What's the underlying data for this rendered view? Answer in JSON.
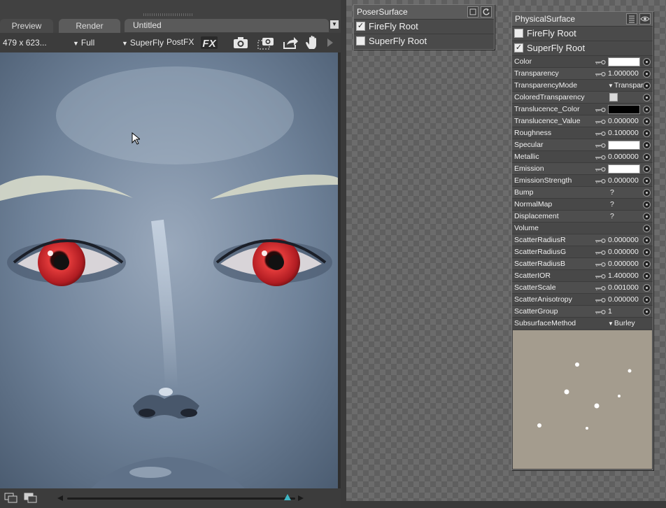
{
  "render_panel": {
    "tabs": [
      {
        "label": "Preview"
      },
      {
        "label": "Render"
      }
    ],
    "document_title": "Untitled",
    "toolbar": {
      "resolution": "479 x 623...",
      "quality": "Full",
      "engine": "SuperFly",
      "postfx": "PostFX",
      "icons": [
        "fx-icon",
        "camera-icon",
        "area-render-icon",
        "export-icon",
        "hand-icon",
        "play-arrow-icon"
      ]
    }
  },
  "poser_surface": {
    "title": "PoserSurface",
    "roots": [
      {
        "label": "FireFly Root",
        "checked": true
      },
      {
        "label": "SuperFly Root",
        "checked": false
      }
    ]
  },
  "physical_surface": {
    "title": "PhysicalSurface",
    "roots": [
      {
        "label": "FireFly Root",
        "checked": false
      },
      {
        "label": "SuperFly Root",
        "checked": true
      }
    ],
    "params": [
      {
        "name": "Color",
        "kind": "color",
        "color": "#ffffff"
      },
      {
        "name": "Transparency",
        "kind": "value",
        "value": "1.000000"
      },
      {
        "name": "TransparencyMode",
        "kind": "dropdown",
        "value": "Transpare"
      },
      {
        "name": "ColoredTransparency",
        "kind": "check",
        "checked": false
      },
      {
        "name": "Translucence_Color",
        "kind": "color",
        "color": "#000000"
      },
      {
        "name": "Translucence_Value",
        "kind": "value",
        "value": "0.000000"
      },
      {
        "name": "Roughness",
        "kind": "value",
        "value": "0.100000"
      },
      {
        "name": "Specular",
        "kind": "color",
        "color": "#ffffff"
      },
      {
        "name": "Metallic",
        "kind": "value",
        "value": "0.000000"
      },
      {
        "name": "Emission",
        "kind": "color",
        "color": "#ffffff"
      },
      {
        "name": "EmissionStrength",
        "kind": "value",
        "value": "0.000000"
      },
      {
        "name": "Bump",
        "kind": "unknown",
        "value": "?"
      },
      {
        "name": "NormalMap",
        "kind": "unknown",
        "value": "?"
      },
      {
        "name": "Displacement",
        "kind": "unknown",
        "value": "?"
      },
      {
        "name": "Volume",
        "kind": "empty"
      },
      {
        "name": "ScatterRadiusR",
        "kind": "value",
        "value": "0.000000"
      },
      {
        "name": "ScatterRadiusG",
        "kind": "value",
        "value": "0.000000"
      },
      {
        "name": "ScatterRadiusB",
        "kind": "value",
        "value": "0.000000"
      },
      {
        "name": "ScatterIOR",
        "kind": "value",
        "value": "1.400000"
      },
      {
        "name": "ScatterScale",
        "kind": "value",
        "value": "0.001000"
      },
      {
        "name": "ScatterAnisotropy",
        "kind": "value",
        "value": "0.000000"
      },
      {
        "name": "ScatterGroup",
        "kind": "value",
        "value": "1"
      },
      {
        "name": "SubsurfaceMethod",
        "kind": "dropdown-noport",
        "value": "Burley"
      }
    ]
  },
  "colors": {
    "panel_bg": "#414141",
    "node_bg": "#444444",
    "skin_blue": "#6e8197",
    "eye_red": "#c0242a",
    "preview_bg": "#a49c8e",
    "accent_thumb": "#3fb6c4"
  }
}
